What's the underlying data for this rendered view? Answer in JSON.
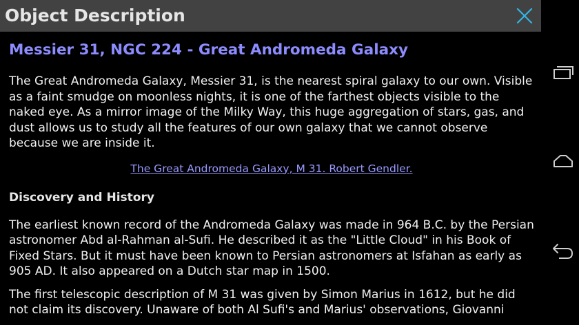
{
  "dialog": {
    "title": "Object Description",
    "close_icon": "close-icon"
  },
  "content": {
    "heading": "Messier 31, NGC 224 - Great Andromeda Galaxy",
    "intro": "The Great Andromeda Galaxy, Messier 31, is the nearest spiral galaxy to our own. Visible as a faint smudge on moonless nights, it is one of the farthest objects visible to the naked eye. As a mirror image of the Milky Way, this huge aggregation of stars, gas, and dust allows us to study all the features of our own galaxy that we cannot observe because we are inside it.",
    "image_link": "The Great Andromeda Galaxy, M 31. Robert Gendler.",
    "section_heading": "Discovery and History",
    "history_paragraph": "The earliest known record of the Andromeda Galaxy was made in 964 B.C. by the Persian astronomer Abd al-Rahman al-Sufi. He described it as the \"Little Cloud\" in his Book of Fixed Stars. But it must have been known to Persian astronomers at Isfahan as early as 905 AD. It also appeared on a Dutch star map in 1500.",
    "telescope_paragraph": "The first telescopic description of M 31 was given by Simon Marius in 1612, but he did not claim its discovery. Unaware of both Al Sufi's and Marius' observations, Giovanni"
  },
  "navbar": {
    "recent_apps_icon": "recent-apps-icon",
    "home_icon": "home-icon",
    "back_icon": "back-icon"
  },
  "colors": {
    "titlebar_bg": "#424242",
    "close_accent": "#33b5e5",
    "heading": "#8c8cff",
    "link": "#9999ff",
    "text": "#f0f0f0"
  }
}
